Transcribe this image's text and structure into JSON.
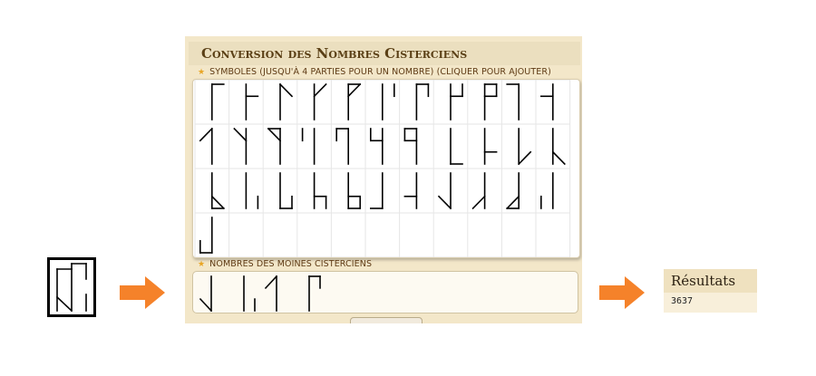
{
  "sample": {
    "value": 3637,
    "glyph": [
      6,
      3,
      6,
      3
    ]
  },
  "panel": {
    "title": "Conversion des Nombres Cisterciens",
    "symbols_label": "SYMBOLES (JUSQU'À 4 PARTIES POUR UN NOMBRE) (CLIQUER POUR AJOUTER)",
    "monks_label": "NOMBRES DES MOINES CISTERCIENS"
  },
  "symbols": [
    {
      "value": 0
    },
    {
      "value": 1
    },
    {
      "value": 2
    },
    {
      "value": 3
    },
    {
      "value": 4
    },
    {
      "value": 5
    },
    {
      "value": 6
    },
    {
      "value": 7
    },
    {
      "value": 8
    },
    {
      "value": 9
    },
    {
      "value": 10
    },
    {
      "value": 20
    },
    {
      "value": 30
    },
    {
      "value": 40
    },
    {
      "value": 50
    },
    {
      "value": 60
    },
    {
      "value": 70
    },
    {
      "value": 80
    },
    {
      "value": 90
    },
    {
      "value": 100
    },
    {
      "value": 200
    },
    {
      "value": 300
    },
    {
      "value": 400
    },
    {
      "value": 500
    },
    {
      "value": 600
    },
    {
      "value": 700
    },
    {
      "value": 800
    },
    {
      "value": 900
    },
    {
      "value": 1000
    },
    {
      "value": 2000
    },
    {
      "value": 3000
    },
    {
      "value": 4000
    },
    {
      "value": 5000
    },
    {
      "value": 6000
    },
    {
      "value": 7000
    },
    {
      "value": 8000
    },
    {
      "value": 9000
    }
  ],
  "input_parts": [
    3000,
    600,
    30,
    7
  ],
  "results": {
    "title": "Résultats",
    "value": "3637"
  },
  "colors": {
    "panel_bg": "#f3e7c9",
    "title_text": "#5a3f15",
    "star": "#e8a524",
    "arrow": "#f5822a"
  },
  "icons": {
    "arrow": "arrow-right-icon",
    "star": "star-icon"
  }
}
